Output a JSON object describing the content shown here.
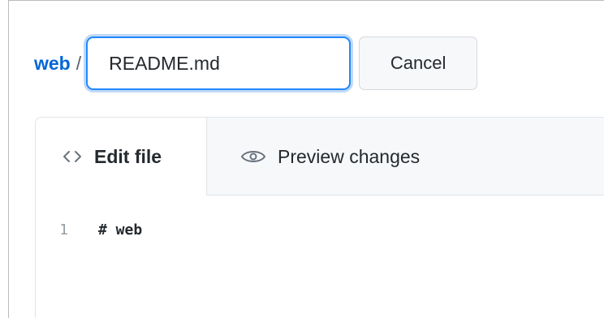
{
  "breadcrumb": {
    "repo": "web",
    "separator": "/"
  },
  "filename_input": {
    "value": "README.md"
  },
  "cancel_button": {
    "label": "Cancel"
  },
  "tabs": [
    {
      "label": "Edit file",
      "icon": "code-icon",
      "active": true
    },
    {
      "label": "Preview changes",
      "icon": "eye-icon",
      "active": false
    }
  ],
  "editor": {
    "lines": [
      {
        "number": "1",
        "text": "# web"
      }
    ]
  },
  "colors": {
    "link": "#0366d6",
    "focus_border": "#2188ff",
    "tab_bar_bg": "#f6f8fa",
    "line_number": "#959da5"
  }
}
